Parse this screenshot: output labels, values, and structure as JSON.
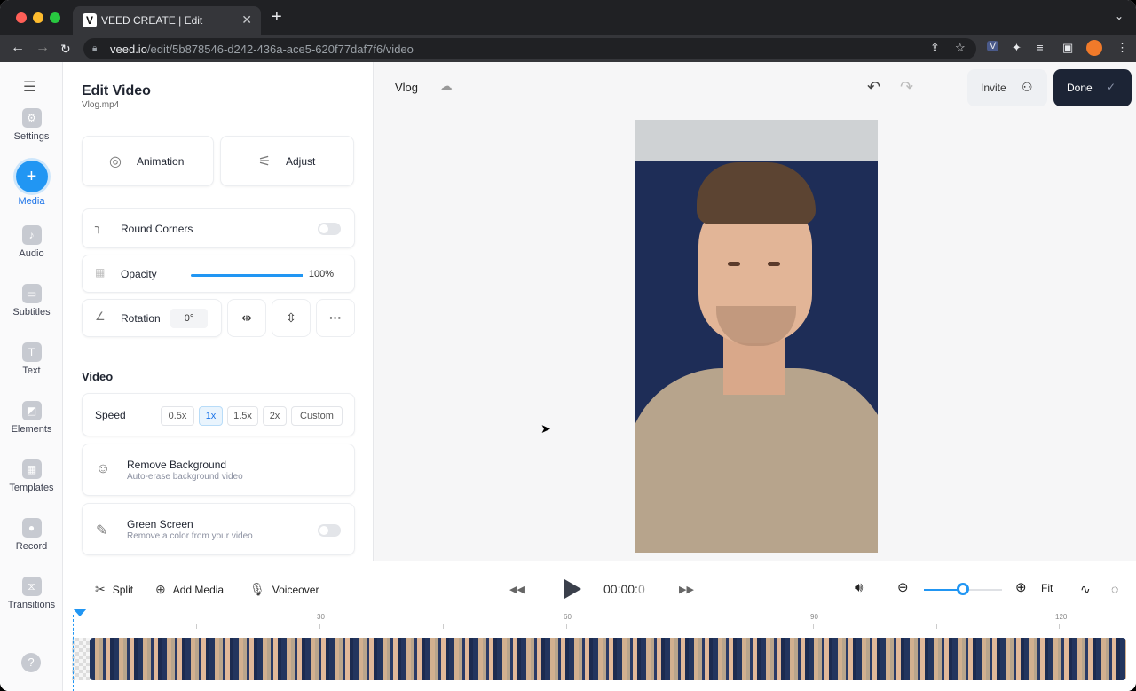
{
  "browser": {
    "tab_title": "VEED CREATE | Edit",
    "url_host": "veed.io",
    "url_path": "/edit/5b878546-d242-436a-ace5-620f77daf7f6/video"
  },
  "rail": [
    {
      "label": "Settings",
      "icon": "gear-icon"
    },
    {
      "label": "Media",
      "icon": "plus-icon",
      "active": true
    },
    {
      "label": "Audio",
      "icon": "music-icon"
    },
    {
      "label": "Subtitles",
      "icon": "subtitles-icon"
    },
    {
      "label": "Text",
      "icon": "text-icon"
    },
    {
      "label": "Elements",
      "icon": "elements-icon"
    },
    {
      "label": "Templates",
      "icon": "templates-icon"
    },
    {
      "label": "Record",
      "icon": "record-icon"
    },
    {
      "label": "Transitions",
      "icon": "transitions-icon"
    }
  ],
  "panel": {
    "title": "Edit Video",
    "filename": "Vlog.mp4",
    "animation": "Animation",
    "adjust": "Adjust",
    "round_corners": "Round Corners",
    "opacity": {
      "label": "Opacity",
      "value": "100%",
      "level": 1.0
    },
    "rotation": {
      "label": "Rotation",
      "value": "0°"
    },
    "video_header": "Video",
    "speed": {
      "label": "Speed",
      "options": [
        "0.5x",
        "1x",
        "1.5x",
        "2x",
        "Custom"
      ],
      "selected": "1x"
    },
    "remove_bg": {
      "title": "Remove Background",
      "desc": "Auto-erase background video"
    },
    "green_screen": {
      "title": "Green Screen",
      "desc": "Remove a color from your video"
    }
  },
  "canvas": {
    "project_name": "Vlog",
    "invite": "Invite",
    "done": "Done"
  },
  "timeline": {
    "split": "Split",
    "add_media": "Add Media",
    "voiceover": "Voiceover",
    "time_main": "00:00:",
    "time_frac": "0",
    "fit": "Fit",
    "ruler": [
      "30",
      "60",
      "90",
      "120"
    ]
  },
  "colors": {
    "accent": "#2196f3",
    "done_bg": "#1c2435"
  }
}
